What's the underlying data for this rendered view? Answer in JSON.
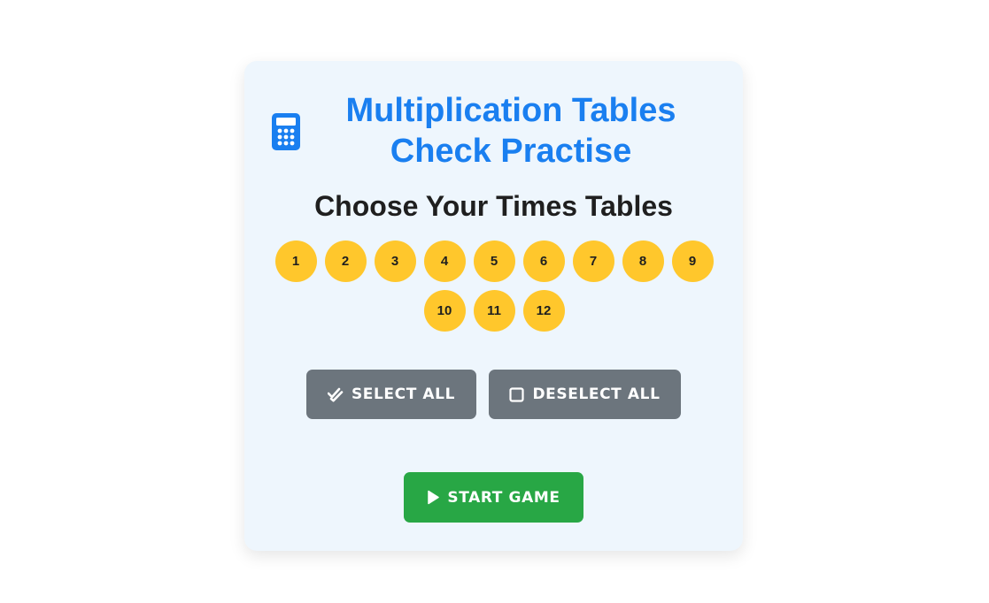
{
  "header": {
    "icon": "calculator-icon",
    "title_line1": "Multiplication Tables",
    "title_line2": "Check Practise"
  },
  "subtitle": "Choose Your Times Tables",
  "tables": [
    "1",
    "2",
    "3",
    "4",
    "5",
    "6",
    "7",
    "8",
    "9",
    "10",
    "11",
    "12"
  ],
  "actions": {
    "select_all_icon": "double-check-icon",
    "select_all_label": "SELECT ALL",
    "deselect_all_icon": "empty-checkbox-icon",
    "deselect_all_label": "DESELECT ALL",
    "start_icon": "play-icon",
    "start_label": "START GAME"
  },
  "colors": {
    "title": "#1a7ff0",
    "card_background": "#eef6fd",
    "number_button": "#ffc72c",
    "secondary_button": "#6c757d",
    "start_button": "#28a745"
  }
}
